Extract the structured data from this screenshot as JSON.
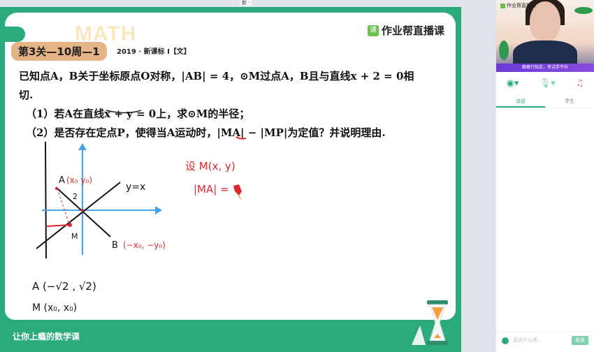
{
  "topbar": {
    "language_indicator": "新 ·"
  },
  "slide": {
    "watermark": "MATH",
    "brand": {
      "icon": "课",
      "name": "作业帮直播课"
    },
    "badge": "第3关—10周—1",
    "source": "2019 · 新课标 Ⅰ【文】",
    "problem": {
      "stem_line1": "已知点A，B关于坐标原点O对称，|AB| = 4，⊙M过点A，B且与直线x + 2 = 0相",
      "stem_line2": "切.",
      "q1": "（1）若A在直线x + y = 0上，求⊙M的半径；",
      "q2": "（2）是否存在定点P，使得当A运动时，|MA| − |MP|为定值？并说明理由."
    },
    "handwriting": {
      "point_a": "A",
      "point_a_coords": "(x₀  y₀)",
      "point_b": "B",
      "point_b_coords": "(−x₀, −y₀)",
      "line_label": "y=x",
      "segment_label": "2",
      "point_m": "M",
      "set_m": "设 M(x, y)",
      "ma_expr": "|MA| =",
      "note_a": "A (−√2 , √2)",
      "note_m": "M (x₀, x₀)"
    },
    "footer": "让你上瘾的数学课"
  },
  "side_panel": {
    "video": {
      "logo": "作业帮直播课",
      "caption": "跟着行知走，考试手不抖"
    },
    "controls": [
      "camera-icon",
      "microphone-icon",
      "music-off-icon"
    ],
    "tabs": [
      {
        "label": "消息",
        "active": true
      },
      {
        "label": "学生",
        "active": false
      }
    ],
    "chat": {
      "placeholder": "说点什么吧...",
      "send_label": "发送"
    }
  },
  "colors": {
    "brand_green": "#2bab7c",
    "badge": "#e4b485",
    "ink_red": "#e0262e",
    "axis_blue": "#4aa3e8"
  }
}
